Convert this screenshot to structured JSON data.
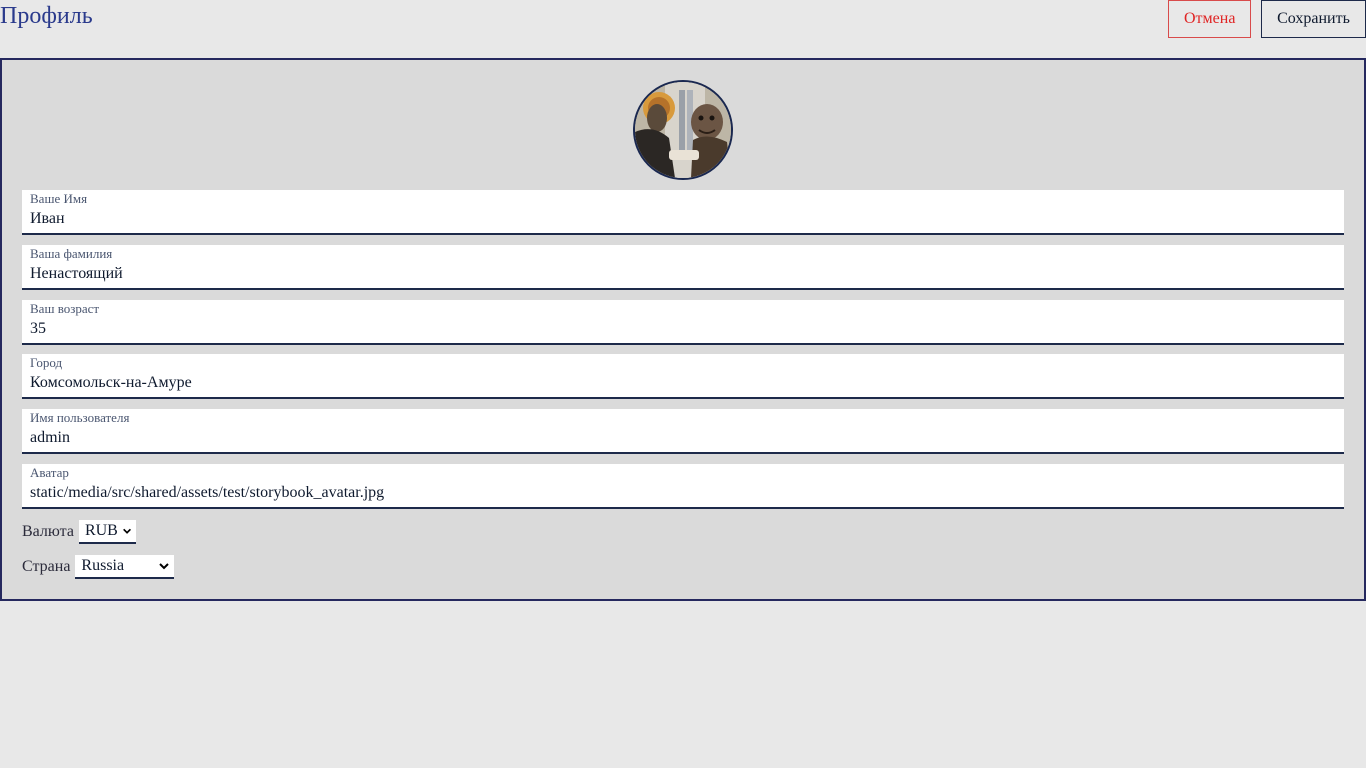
{
  "header": {
    "title": "Профиль",
    "cancel_label": "Отмена",
    "save_label": "Сохранить"
  },
  "form": {
    "fields": [
      {
        "label": "Ваше Имя",
        "value": "Иван"
      },
      {
        "label": "Ваша фамилия",
        "value": "Ненастоящий"
      },
      {
        "label": "Ваш возраст",
        "value": "35"
      },
      {
        "label": "Город",
        "value": "Комсомольск-на-Амуре"
      },
      {
        "label": "Имя пользователя",
        "value": "admin"
      },
      {
        "label": "Аватар",
        "value": "static/media/src/shared/assets/test/storybook_avatar.jpg"
      }
    ],
    "currency": {
      "label": "Валюта",
      "value": "RUB"
    },
    "country": {
      "label": "Страна",
      "value": "Russia"
    }
  },
  "colors": {
    "background": "#e8e8e8",
    "card": "#dadada",
    "accent": "#25285e",
    "title": "#2a3a8c",
    "cancel": "#e02424"
  },
  "icons": {
    "select_chevron": "chevron-down-icon"
  }
}
